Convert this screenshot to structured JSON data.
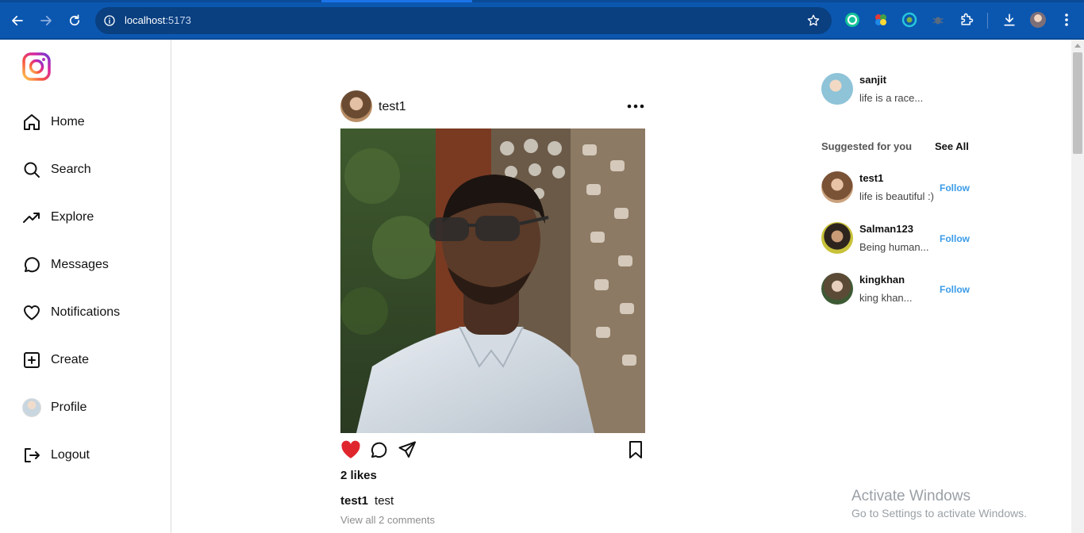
{
  "browser": {
    "host": "localhost",
    "port": ":5173"
  },
  "sidebar": {
    "items": [
      {
        "label": "Home",
        "icon": "home-icon"
      },
      {
        "label": "Search",
        "icon": "search-icon"
      },
      {
        "label": "Explore",
        "icon": "trending-up-icon"
      },
      {
        "label": "Messages",
        "icon": "message-circle-icon"
      },
      {
        "label": "Notifications",
        "icon": "heart-icon"
      },
      {
        "label": "Create",
        "icon": "plus-square-icon"
      },
      {
        "label": "Profile",
        "icon": "avatar"
      },
      {
        "label": "Logout",
        "icon": "logout-icon"
      }
    ]
  },
  "post": {
    "username": "test1",
    "likes": "2 likes",
    "caption_user": "test1",
    "caption_text": "test",
    "comments_link": "View all 2 comments",
    "liked": true
  },
  "current_user": {
    "username": "sanjit",
    "bio": "life is a race..."
  },
  "suggestions": {
    "title": "Suggested for you",
    "see_all": "See All",
    "users": [
      {
        "username": "test1",
        "bio": "life is beautiful :)",
        "action": "Follow"
      },
      {
        "username": "Salman123",
        "bio": "Being human...",
        "action": "Follow"
      },
      {
        "username": "kingkhan",
        "bio": "king khan...",
        "action": "Follow"
      }
    ]
  },
  "watermark": {
    "line1": "Activate Windows",
    "line2": "Go to Settings to activate Windows."
  },
  "colors": {
    "chrome_bar": "#0b57b0",
    "like_red": "#e0262d",
    "follow_blue": "#3a9be8"
  }
}
